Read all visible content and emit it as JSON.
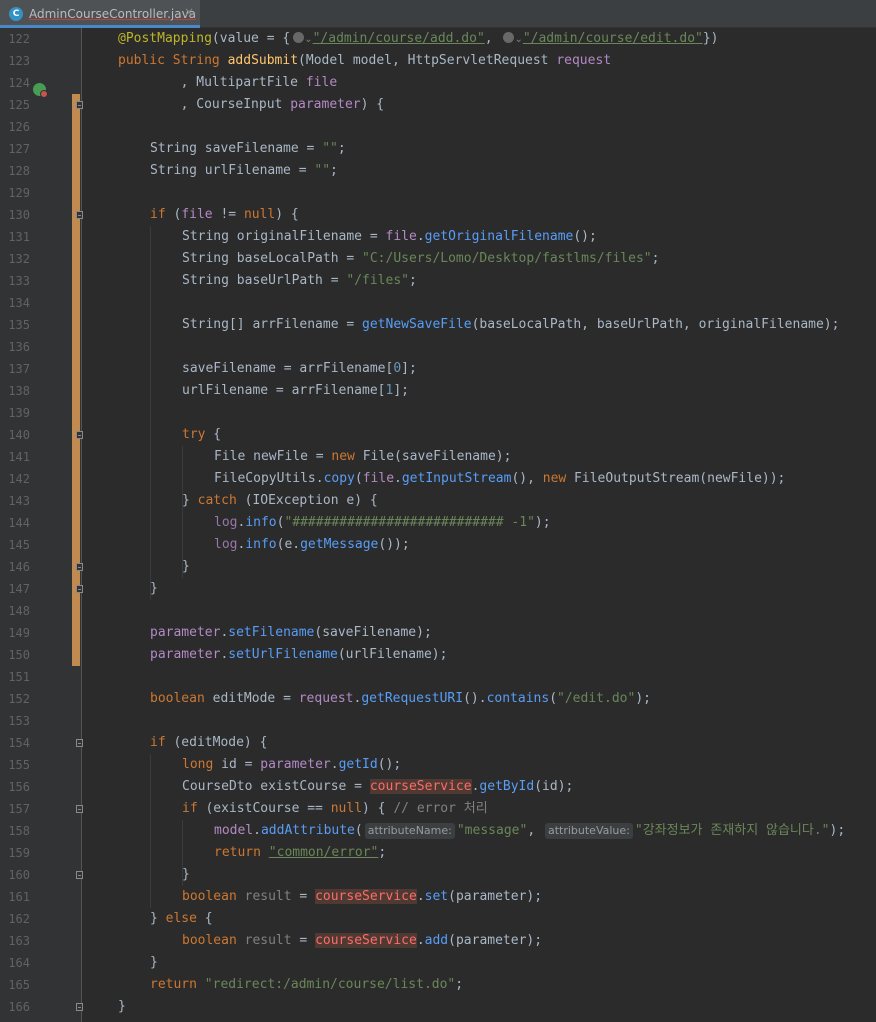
{
  "tab": {
    "title": "AdminCourseController.java",
    "icon": "java-class-icon",
    "icon_letter": "C",
    "close": "×"
  },
  "code": {
    "ann_name": "@PostMapping",
    "ann_open": "(value = {",
    "url_add": "\"/admin/course/add.do\"",
    "comma": ", ",
    "url_edit": "\"/admin/course/edit.do\"",
    "ann_close": "})",
    "kw_public": "public",
    "type_string": "String",
    "m_addSubmit": "addSubmit",
    "sig1": "(Model model, HttpServletRequest ",
    "p_request": "request",
    "l124": "        , MultipartFile ",
    "p_file": "file",
    "l125": "        , CourseInput ",
    "p_parameter": "parameter",
    "l125_end": ") {",
    "l127": "String saveFilename = ",
    "empty_str": "\"\"",
    "semi": ";",
    "l128": "String urlFilename = ",
    "kw_if": "if",
    "l130_a": " (",
    "v_file": "file",
    "l130_b": " != ",
    "kw_null": "null",
    "l130_c": ") {",
    "l131": "String originalFilename = ",
    "m_getOriginalFilename": "getOriginalFilename",
    "paren_semi": "();",
    "l132": "String baseLocalPath = ",
    "s_base_local": "\"C:/Users/Lomo/Desktop/fastlms/files\"",
    "l133": "String baseUrlPath = ",
    "s_files": "\"/files\"",
    "l135": "String[] arrFilename = ",
    "m_getNewSaveFile": "getNewSaveFile",
    "l135_args": "(baseLocalPath, baseUrlPath, originalFilename);",
    "l137": "saveFilename = arrFilename[",
    "n0": "0",
    "l137_end": "];",
    "l138": "urlFilename = arrFilename[",
    "n1": "1",
    "kw_try": "try",
    "brace_open": " {",
    "l141": "File newFile = ",
    "kw_new": "new",
    "l141_b": " File(saveFilename);",
    "l142_a": "FileCopyUtils.",
    "m_copy": "copy",
    "m_getInputStream": "getInputStream",
    "l142_b": "(), ",
    "l142_c": " FileOutputStream(newFile));",
    "brace_close": "}",
    "kw_catch": "catch",
    "l143_b": " (IOException e) {",
    "f_log": "log",
    "m_info": "info",
    "s_hash": "\"########################### -1\"",
    "paren_close_semi": ");",
    "l145_b": "(e.",
    "m_getMessage": "getMessage",
    "l145_c": "());",
    "m_setFilename": "setFilename",
    "l149_b": "(saveFilename);",
    "m_setUrlFilename": "setUrlFilename",
    "l150_b": "(urlFilename);",
    "kw_boolean": "boolean",
    "l152_a": " editMode = ",
    "m_getRequestURI": "getRequestURI",
    "m_contains": "contains",
    "s_edit": "\"/edit.do\"",
    "l154_b": " (editMode) {",
    "kw_long": "long",
    "l155_a": " id = ",
    "m_getId": "getId",
    "l156_a": "CourseDto existCourse = ",
    "f_courseService": "courseService",
    "m_getById": "getById",
    "l156_b": "(id);",
    "l157_b": " (existCourse == ",
    "l157_c": ") { ",
    "cmt_error": "// error 처리",
    "v_model": "model",
    "m_addAttribute": "addAttribute",
    "hint_attrName": "attributeName:",
    "s_message": "\"message\"",
    "hint_attrValue": "attributeValue:",
    "s_korean": "\"강좌정보가 존재하지 않습니다.\"",
    "kw_return": "return",
    "s_common_error": "\"common/error\"",
    "v_result": "result",
    "m_set": "set",
    "l161_b": "(parameter);",
    "kw_else": "else",
    "m_add": "add",
    "s_redirect": "\"redirect:/admin/course/list.do\"",
    "sp": " ",
    "dot": ".",
    "open_paren": "(",
    "close_brace_else": "} "
  },
  "line_numbers": [
    "122",
    "123",
    "124",
    "125",
    "126",
    "127",
    "128",
    "129",
    "130",
    "131",
    "132",
    "133",
    "134",
    "135",
    "136",
    "137",
    "138",
    "139",
    "140",
    "141",
    "142",
    "143",
    "144",
    "145",
    "146",
    "147",
    "148",
    "149",
    "150",
    "151",
    "152",
    "153",
    "154",
    "155",
    "156",
    "157",
    "158",
    "159",
    "160",
    "161",
    "162",
    "163",
    "164",
    "165",
    "166"
  ]
}
